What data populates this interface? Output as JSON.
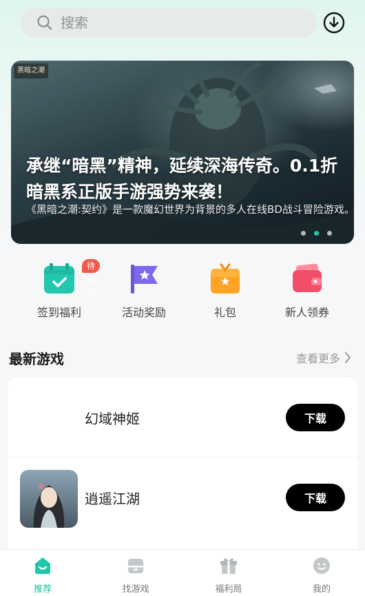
{
  "search": {
    "placeholder": "搜索"
  },
  "banner": {
    "logo_text": "黑暗之潮",
    "title": "承继“暗黑”精神，延续深海传奇。0.1折暗黑系正版手游强势来袭！",
    "description": "《黑暗之潮:契约》是一款魔幻世界为背景的多人在线BD战斗冒险游戏。",
    "dots": 3,
    "active_dot": 1
  },
  "quick_actions": [
    {
      "label": "签到福利",
      "badge": "待签到",
      "icon": "calendar-check-icon"
    },
    {
      "label": "活动奖励",
      "icon": "flag-star-icon"
    },
    {
      "label": "礼包",
      "icon": "gift-box-icon"
    },
    {
      "label": "新人领券",
      "icon": "wallet-coupon-icon"
    }
  ],
  "section": {
    "title": "最新游戏",
    "more": "查看更多"
  },
  "games": [
    {
      "name": "幻域神姬",
      "button": "下载"
    },
    {
      "name": "逍遥江湖",
      "button": "下载"
    }
  ],
  "nav": [
    {
      "label": "推荐",
      "icon": "home-face-icon",
      "active": true
    },
    {
      "label": "找游戏",
      "icon": "game-box-icon"
    },
    {
      "label": "福利局",
      "icon": "gift-icon"
    },
    {
      "label": "我的",
      "icon": "profile-face-icon"
    }
  ],
  "colors": {
    "accent": "#1fc8a8",
    "badge": "#f05a4a",
    "button": "#000000"
  }
}
